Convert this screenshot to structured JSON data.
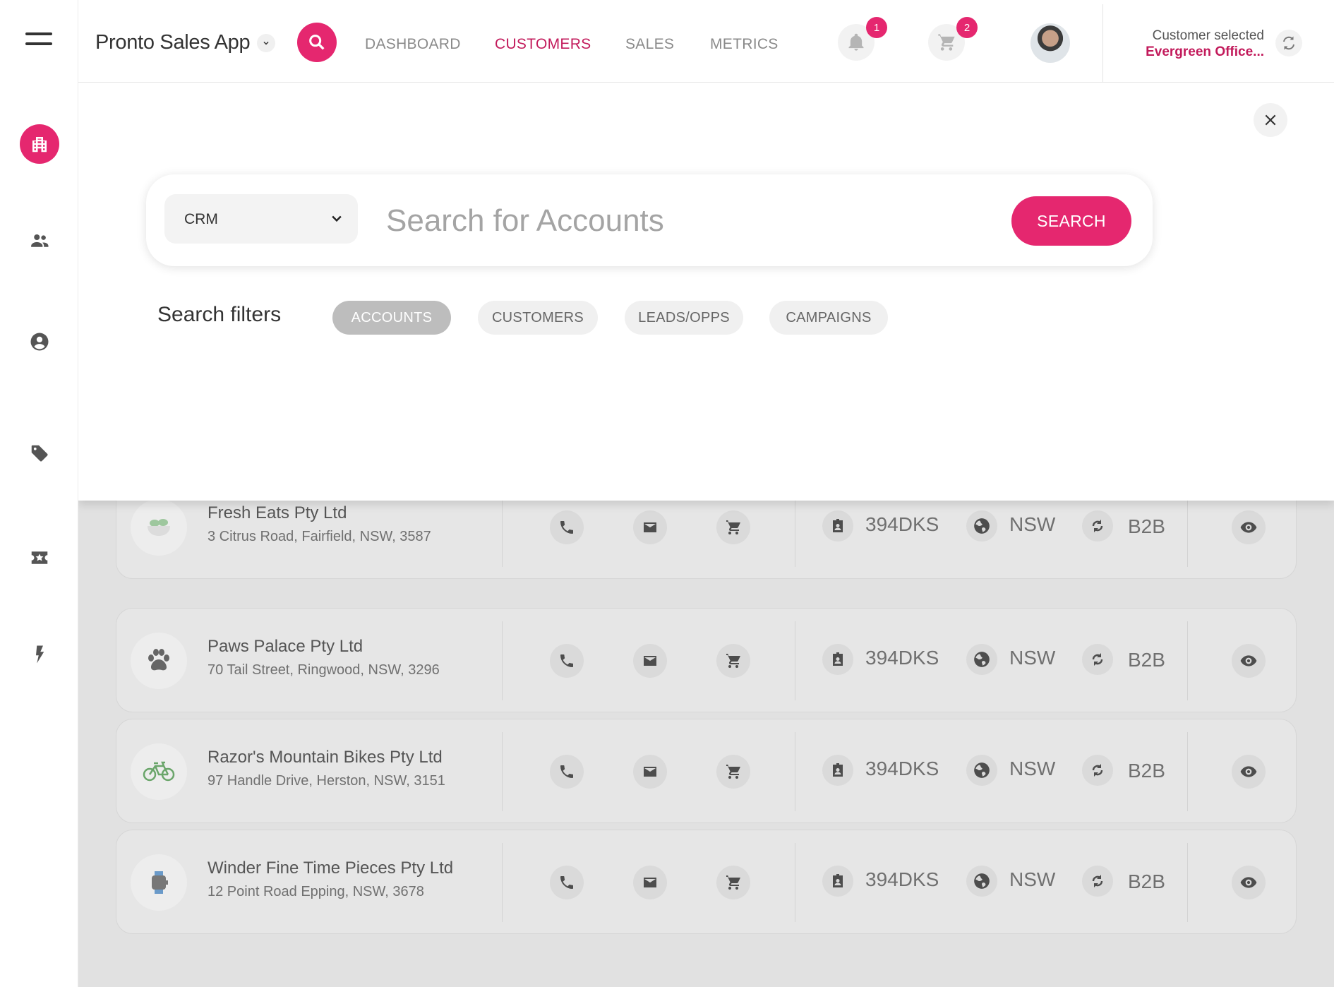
{
  "header": {
    "app_name": "Pronto Sales App",
    "nav": [
      "DASHBOARD",
      "CUSTOMERS",
      "SALES",
      "METRICS"
    ],
    "active_nav": "CUSTOMERS",
    "notifications_count": "1",
    "cart_count": "2",
    "customer_label": "Customer selected",
    "customer_value": "Evergreen Office..."
  },
  "sidebar": {
    "items": [
      "menu-icon",
      "building-icon",
      "people-icon",
      "account-circle-icon",
      "tag-icon",
      "ticket-star-icon",
      "bolt-icon"
    ],
    "active": "building-icon"
  },
  "search": {
    "source": "CRM",
    "placeholder": "Search for Accounts",
    "button": "SEARCH",
    "filters_title": "Search filters",
    "filters": [
      "ACCOUNTS",
      "CUSTOMERS",
      "LEADS/OPPS",
      "CAMPAIGNS"
    ],
    "active_filter": "ACCOUNTS"
  },
  "accounts": [
    {
      "name": "Fresh Eats Pty Ltd",
      "address": "3 Citrus Road, Fairfield, NSW, 3587",
      "logo": "salad-bowl-icon",
      "code": "394DKS",
      "region": "NSW",
      "type": "B2B"
    },
    {
      "name": "Paws Palace Pty Ltd",
      "address": "70 Tail Street, Ringwood, NSW, 3296",
      "logo": "paw-icon",
      "code": "394DKS",
      "region": "NSW",
      "type": "B2B"
    },
    {
      "name": "Razor's Mountain Bikes Pty Ltd",
      "address": "97 Handle Drive, Herston, NSW,  3151",
      "logo": "bicycle-icon",
      "code": "394DKS",
      "region": "NSW",
      "type": "B2B"
    },
    {
      "name": "Winder Fine Time Pieces Pty Ltd",
      "address": "12 Point Road Epping, NSW, 3678",
      "logo": "watch-icon",
      "code": "394DKS",
      "region": "NSW",
      "type": "B2B"
    }
  ],
  "colors": {
    "accent": "#e5276f",
    "accent_text": "#c21a5b"
  }
}
